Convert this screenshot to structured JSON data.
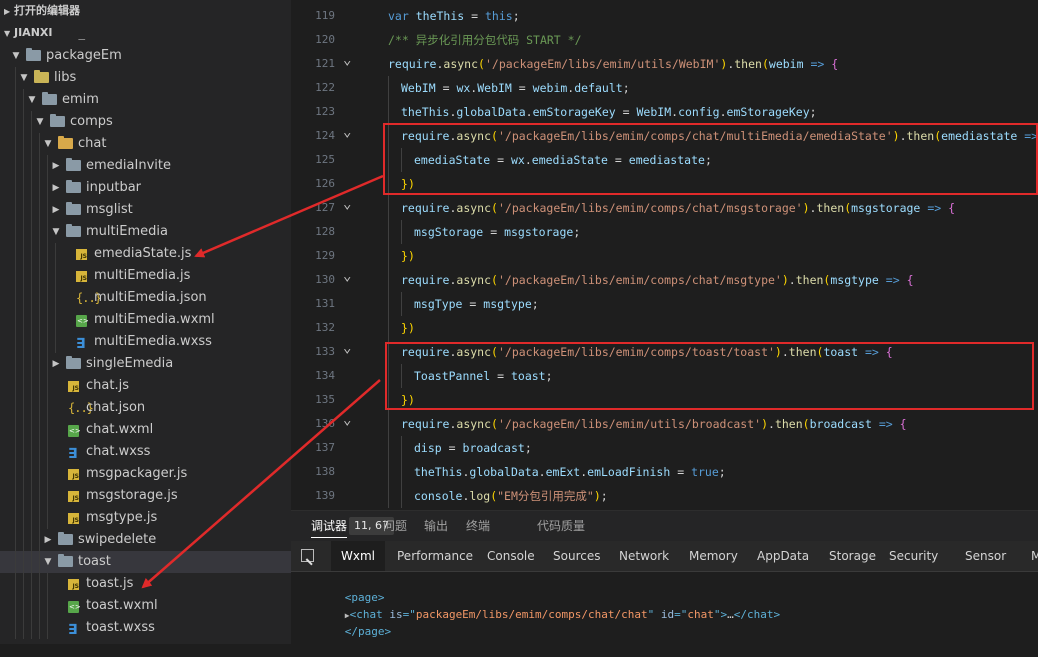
{
  "sidebar": {
    "sections": [
      {
        "label": "打开的编辑器",
        "expanded": false
      },
      {
        "label": "JIANXI",
        "expanded": true
      }
    ],
    "partial_item": "node_modules",
    "tree": [
      {
        "label": "packageEm",
        "kind": "folder",
        "depth": 1,
        "expanded": true
      },
      {
        "label": "libs",
        "kind": "folder-libs",
        "depth": 2,
        "expanded": true
      },
      {
        "label": "emim",
        "kind": "folder",
        "depth": 3,
        "expanded": true
      },
      {
        "label": "comps",
        "kind": "folder",
        "depth": 4,
        "expanded": true
      },
      {
        "label": "chat",
        "kind": "folder-open",
        "depth": 5,
        "expanded": true
      },
      {
        "label": "emediaInvite",
        "kind": "folder",
        "depth": 6,
        "expanded": false
      },
      {
        "label": "inputbar",
        "kind": "folder",
        "depth": 6,
        "expanded": false
      },
      {
        "label": "msglist",
        "kind": "folder",
        "depth": 6,
        "expanded": false
      },
      {
        "label": "multiEmedia",
        "kind": "folder",
        "depth": 6,
        "expanded": true
      },
      {
        "label": "emediaState.js",
        "kind": "js",
        "depth": 7
      },
      {
        "label": "multiEmedia.js",
        "kind": "js",
        "depth": 7
      },
      {
        "label": "multiEmedia.json",
        "kind": "json",
        "depth": 7
      },
      {
        "label": "multiEmedia.wxml",
        "kind": "wxml",
        "depth": 7
      },
      {
        "label": "multiEmedia.wxss",
        "kind": "wxss",
        "depth": 7
      },
      {
        "label": "singleEmedia",
        "kind": "folder",
        "depth": 6,
        "expanded": false
      },
      {
        "label": "chat.js",
        "kind": "js",
        "depth": 6
      },
      {
        "label": "chat.json",
        "kind": "json",
        "depth": 6
      },
      {
        "label": "chat.wxml",
        "kind": "wxml",
        "depth": 6
      },
      {
        "label": "chat.wxss",
        "kind": "wxss",
        "depth": 6
      },
      {
        "label": "msgpackager.js",
        "kind": "js",
        "depth": 6
      },
      {
        "label": "msgstorage.js",
        "kind": "js",
        "depth": 6
      },
      {
        "label": "msgtype.js",
        "kind": "js",
        "depth": 6
      },
      {
        "label": "swipedelete",
        "kind": "folder",
        "depth": 5,
        "expanded": false
      },
      {
        "label": "toast",
        "kind": "folder",
        "depth": 5,
        "expanded": true,
        "selected": true
      },
      {
        "label": "toast.js",
        "kind": "js",
        "depth": 6
      },
      {
        "label": "toast.wxml",
        "kind": "wxml",
        "depth": 6
      },
      {
        "label": "toast.wxss",
        "kind": "wxss",
        "depth": 6
      }
    ]
  },
  "editor": {
    "lines": [
      {
        "n": "119",
        "fold": false,
        "indent": 0,
        "code": "var theThis = this;"
      },
      {
        "n": "120",
        "fold": false,
        "indent": 0,
        "code": "/** 异步化引用分包代码 START */"
      },
      {
        "n": "121",
        "fold": true,
        "indent": 0,
        "code": "require.async('/packageEm/libs/emim/utils/WebIM').then(webim => {"
      },
      {
        "n": "122",
        "fold": false,
        "indent": 1,
        "code": "WebIM = wx.WebIM = webim.default;"
      },
      {
        "n": "123",
        "fold": false,
        "indent": 1,
        "code": "theThis.globalData.emStorageKey = WebIM.config.emStorageKey;"
      },
      {
        "n": "124",
        "fold": true,
        "indent": 1,
        "code": "require.async('/packageEm/libs/emim/comps/chat/multiEmedia/emediaState').then(emediastate => {"
      },
      {
        "n": "125",
        "fold": false,
        "indent": 2,
        "code": "emediaState = wx.emediaState = emediastate;"
      },
      {
        "n": "126",
        "fold": false,
        "indent": 1,
        "code": "})"
      },
      {
        "n": "127",
        "fold": true,
        "indent": 1,
        "code": "require.async('/packageEm/libs/emim/comps/chat/msgstorage').then(msgstorage => {"
      },
      {
        "n": "128",
        "fold": false,
        "indent": 2,
        "code": "msgStorage = msgstorage;"
      },
      {
        "n": "129",
        "fold": false,
        "indent": 1,
        "code": "})"
      },
      {
        "n": "130",
        "fold": true,
        "indent": 1,
        "code": "require.async('/packageEm/libs/emim/comps/chat/msgtype').then(msgtype => {"
      },
      {
        "n": "131",
        "fold": false,
        "indent": 2,
        "code": "msgType = msgtype;"
      },
      {
        "n": "132",
        "fold": false,
        "indent": 1,
        "code": "})"
      },
      {
        "n": "133",
        "fold": true,
        "indent": 1,
        "code": "require.async('/packageEm/libs/emim/comps/toast/toast').then(toast => {"
      },
      {
        "n": "134",
        "fold": false,
        "indent": 2,
        "code": "ToastPannel = toast;"
      },
      {
        "n": "135",
        "fold": false,
        "indent": 1,
        "code": "})"
      },
      {
        "n": "136",
        "fold": true,
        "indent": 1,
        "code": "require.async('/packageEm/libs/emim/utils/broadcast').then(broadcast => {"
      },
      {
        "n": "137",
        "fold": false,
        "indent": 2,
        "code": "disp = broadcast;"
      },
      {
        "n": "138",
        "fold": false,
        "indent": 2,
        "code": "theThis.globalData.emExt.emLoadFinish = true;"
      },
      {
        "n": "139",
        "fold": false,
        "indent": 2,
        "code": "console.log(\"EM分包引用完成\");"
      }
    ]
  },
  "panel": {
    "tabs": [
      {
        "label": "调试器",
        "active": true,
        "badge": "11, 67"
      },
      {
        "label": "问题",
        "active": false
      },
      {
        "label": "输出",
        "active": false
      },
      {
        "label": "终端",
        "active": false
      },
      {
        "label": "代码质量",
        "active": false
      }
    ],
    "devtools_tabs": [
      {
        "label": "Wxml",
        "active": true
      },
      {
        "label": "Performance",
        "active": false
      },
      {
        "label": "Console",
        "active": false
      },
      {
        "label": "Sources",
        "active": false
      },
      {
        "label": "Network",
        "active": false
      },
      {
        "label": "Memory",
        "active": false
      },
      {
        "label": "AppData",
        "active": false
      },
      {
        "label": "Storage",
        "active": false
      },
      {
        "label": "Security",
        "active": false
      },
      {
        "label": "Sensor",
        "active": false
      },
      {
        "label": "Mo",
        "active": false
      }
    ],
    "dom": {
      "open_page": "<page>",
      "chat_tag": "chat",
      "chat_attr1": "is",
      "chat_val1": "packageEm/libs/emim/comps/chat/chat",
      "chat_attr2": "id",
      "chat_val2": "chat",
      "ellipsis": "…",
      "close_page": "</page>"
    }
  },
  "annotations": {
    "color": "#e02a2a"
  }
}
